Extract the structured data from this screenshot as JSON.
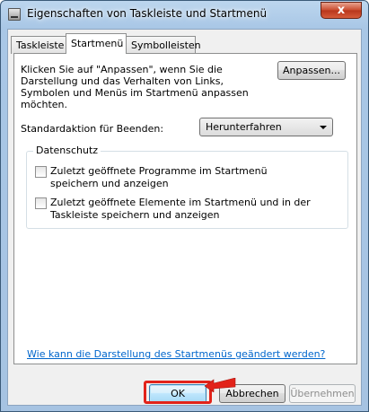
{
  "window": {
    "title": "Eigenschaften von Taskleiste und Startmenü",
    "close_glyph": "x"
  },
  "tabs": [
    {
      "label": "Taskleiste",
      "active": false
    },
    {
      "label": "Startmenü",
      "active": true
    },
    {
      "label": "Symbolleisten",
      "active": false
    }
  ],
  "startmenu": {
    "description": "Klicken Sie auf \"Anpassen\", wenn Sie die Darstellung und das Verhalten von Links, Symbolen und Menüs im Startmenü anpassen möchten.",
    "customize_label": "Anpassen...",
    "power_action_label": "Standardaktion für Beenden:",
    "power_action_value": "Herunterfahren",
    "privacy": {
      "legend": "Datenschutz",
      "items": [
        {
          "label": "Zuletzt geöffnete Programme im Startmenü speichern und anzeigen",
          "checked": false
        },
        {
          "label": "Zuletzt geöffnete Elemente im Startmenü und in der Taskleiste speichern und anzeigen",
          "checked": false
        }
      ]
    },
    "help_link": "Wie kann die Darstellung des Startmenüs geändert werden?"
  },
  "buttons": {
    "ok": "OK",
    "cancel": "Abbrechen",
    "apply": "Übernehmen"
  },
  "colors": {
    "highlight": "#e2231a",
    "link": "#0066cc"
  }
}
